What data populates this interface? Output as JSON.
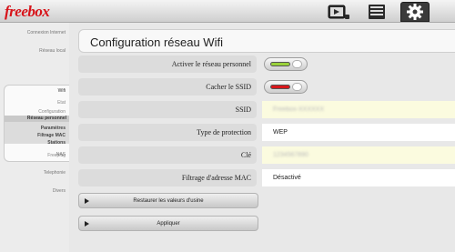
{
  "brand": {
    "logo": "freebox",
    "logo_color": "#d7141a"
  },
  "toolbar": {
    "icons": [
      "media-player-icon",
      "list-icon",
      "gear-icon"
    ],
    "active": "gear-icon"
  },
  "sidebar": {
    "items": [
      "Connexion Internet",
      "Réseau local",
      "NAS",
      "Telephonie",
      "Divers"
    ],
    "wifi": {
      "label": "Wifi",
      "sub": [
        "Etat",
        "Configuration",
        "Freeplug"
      ],
      "active": "Réseau personnel",
      "subsub": [
        "Paramètres",
        "Filtrage MAC",
        "Stations"
      ]
    }
  },
  "main": {
    "title": "Configuration réseau Wifi",
    "rows": [
      {
        "label": "Activer le réseau personnel",
        "toggle": "on"
      },
      {
        "label": "Cacher le SSID",
        "toggle": "off"
      },
      {
        "label": "SSID",
        "value": "Freebox-XXXXXX"
      },
      {
        "label": "Type de protection",
        "value": "WEP"
      },
      {
        "label": "Clé",
        "value": "1234567890"
      },
      {
        "label": "Filtrage d'adresse MAC",
        "value": "Désactivé"
      }
    ],
    "buttons": {
      "restore": "Restaurer les valeurs d'usine",
      "apply": "Appliquer"
    }
  },
  "colors": {
    "toggle_on": "#9ad13a",
    "toggle_off": "#d9171b"
  }
}
